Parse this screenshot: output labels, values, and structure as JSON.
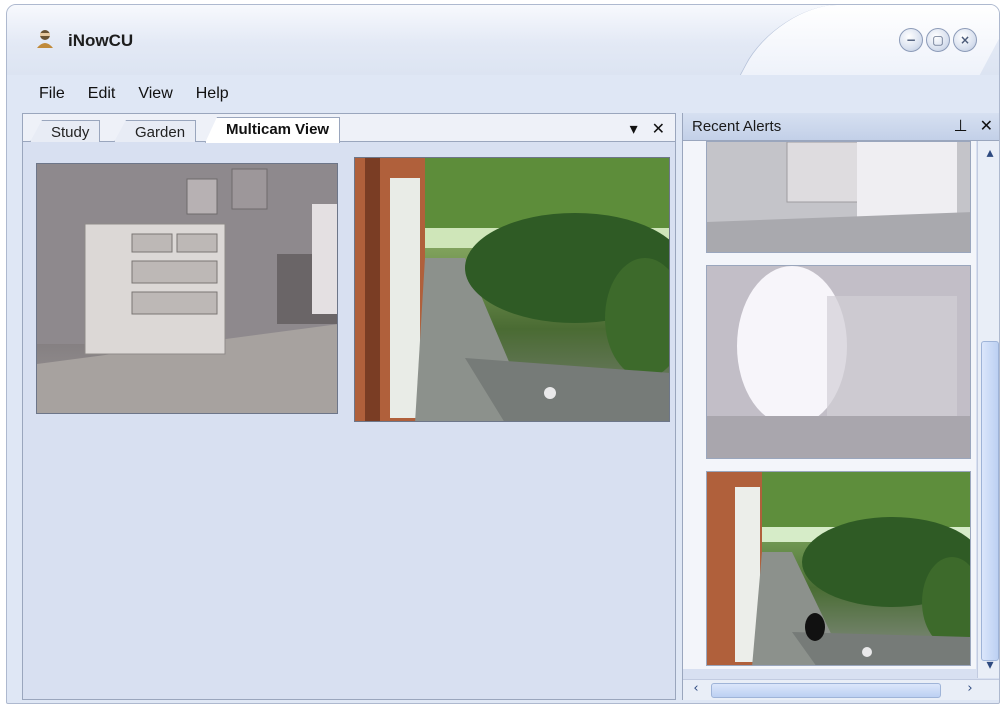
{
  "app": {
    "title": "iNowCU"
  },
  "window_buttons": {
    "minimize": "−",
    "restore": "▢",
    "close": "×"
  },
  "menu": [
    "File",
    "Edit",
    "View",
    "Help"
  ],
  "tabs": [
    {
      "label": "Study",
      "active": false
    },
    {
      "label": "Garden",
      "active": false
    },
    {
      "label": "Multicam View",
      "active": true
    }
  ],
  "tab_tools": {
    "dropdown": "▾",
    "close": "✕"
  },
  "alerts_panel": {
    "title": "Recent Alerts",
    "pin": "⊥",
    "close": "✕"
  },
  "scroll": {
    "up": "▴",
    "down": "▾",
    "left": "‹",
    "right": "›"
  },
  "colors": {
    "window_bg": "#dfe7f5",
    "panel_bg": "#d8e0f1",
    "border": "#9aa6bd"
  }
}
